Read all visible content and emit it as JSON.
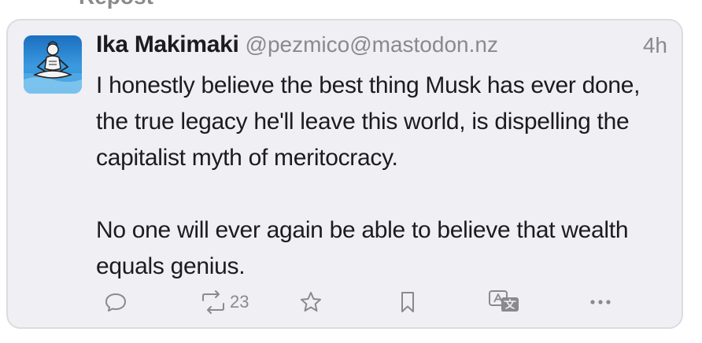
{
  "repost_label": "Repost",
  "post": {
    "author": {
      "display_name": "Ika Makimaki",
      "handle": "@pezmico@mastodon.nz"
    },
    "timestamp": "4h",
    "paragraphs": [
      "I honestly believe the best thing Musk has ever done, the true legacy he'll leave this world, is dispelling the capitalist myth of meritocracy.",
      "No one will ever again be able to believe that wealth equals genius."
    ],
    "actions": {
      "reply_icon": "speech-bubble-icon",
      "boost_icon": "repost-arrows-icon",
      "boost_count": "23",
      "favourite_icon": "star-icon",
      "bookmark_icon": "bookmark-icon",
      "translate_icon": "translate-icon",
      "more_icon": "ellipsis-icon"
    }
  },
  "colors": {
    "card_background": "#efeff4",
    "card_border": "#dcdce0",
    "text_primary": "#1c1c1e",
    "text_secondary": "#8a8a8e"
  }
}
